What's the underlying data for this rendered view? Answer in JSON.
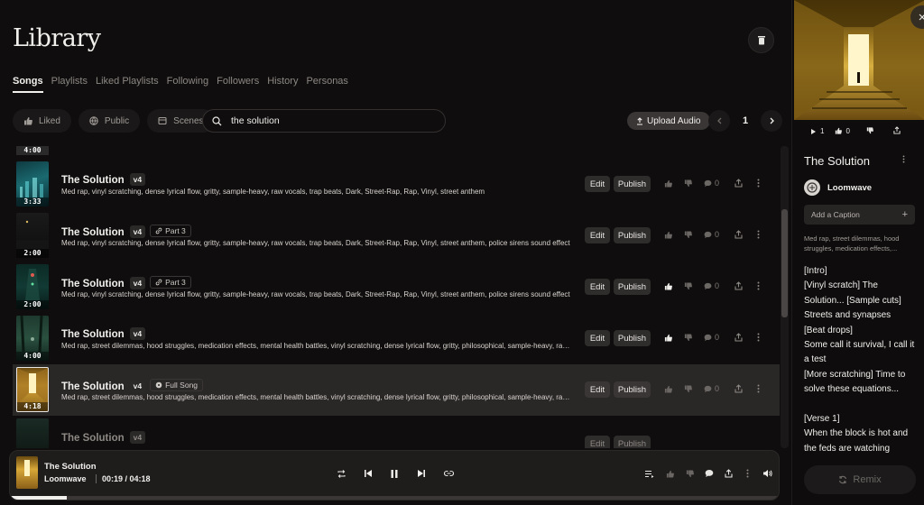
{
  "page": {
    "title": "Library"
  },
  "tabs": [
    {
      "label": "Songs",
      "active": true
    },
    {
      "label": "Playlists",
      "active": false
    },
    {
      "label": "Liked Playlists",
      "active": false
    },
    {
      "label": "Following",
      "active": false
    },
    {
      "label": "Followers",
      "active": false
    },
    {
      "label": "History",
      "active": false
    },
    {
      "label": "Personas",
      "active": false
    }
  ],
  "filters": {
    "liked": "Liked",
    "public": "Public",
    "scenes": "Scenes"
  },
  "search": {
    "value": "the solution",
    "placeholder": "Search"
  },
  "toolbar": {
    "upload_label": "Upload Audio"
  },
  "pagination": {
    "current": "1"
  },
  "partial_row_duration": "4:00",
  "rows": [
    {
      "title": "The Solution",
      "version": "v4",
      "badge": "",
      "duration": "3:33",
      "tags": "Med rap, vinyl scratching, dense lyrical flow, gritty, sample-heavy, raw vocals, trap beats, Dark, Street-Rap, Rap, Vinyl, street anthem",
      "edit": "Edit",
      "publish": "Publish",
      "comments": "0",
      "liked": false
    },
    {
      "title": "The Solution",
      "version": "v4",
      "badge": "Part 3",
      "duration": "2:00",
      "tags": "Med rap, vinyl scratching, dense lyrical flow, gritty, sample-heavy, raw vocals, trap beats, Dark, Street-Rap, Rap, Vinyl, street anthem, police sirens sound effect",
      "edit": "Edit",
      "publish": "Publish",
      "comments": "0",
      "liked": false
    },
    {
      "title": "The Solution",
      "version": "v4",
      "badge": "Part 3",
      "duration": "2:00",
      "tags": "Med rap, vinyl scratching, dense lyrical flow, gritty, sample-heavy, raw vocals, trap beats, Dark, Street-Rap, Rap, Vinyl, street anthem, police sirens sound effect",
      "edit": "Edit",
      "publish": "Publish",
      "comments": "0",
      "liked": true
    },
    {
      "title": "The Solution",
      "version": "v4",
      "badge": "",
      "duration": "4:00",
      "tags": "Med rap, street dilemmas, hood struggles, medication effects, mental health battles, vinyl scratching, dense lyrical flow, gritty, philosophical, sample-heavy, raw vocals",
      "edit": "Edit",
      "publish": "Publish",
      "comments": "0",
      "liked": true
    },
    {
      "title": "The Solution",
      "version": "v4",
      "badge": "Full Song",
      "duration": "4:18",
      "tags": "Med rap, street dilemmas, hood struggles, medication effects, mental health battles, vinyl scratching, dense lyrical flow, gritty, philosophical, sample-heavy, raw vocals",
      "edit": "Edit",
      "publish": "Publish",
      "comments": "0",
      "liked": false
    },
    {
      "title": "The Solution",
      "version": "v4",
      "badge": "",
      "duration": "",
      "tags": "",
      "edit": "Edit",
      "publish": "Publish",
      "comments": "0",
      "liked": false
    }
  ],
  "player": {
    "title": "The Solution",
    "artist": "Loomwave",
    "time": "00:19 / 04:18",
    "progress": 0.074
  },
  "side": {
    "plays": "1",
    "likes": "0",
    "title": "The Solution",
    "artist": "Loomwave",
    "caption_label": "Add a Caption",
    "tags": "Med rap, street dilemmas, hood struggles, medication effects,...",
    "lyrics": "[Intro]\n[Vinyl scratch] The Solution... [Sample cuts]\nStreets and synapses\n[Beat drops]\nSome call it survival, I call it a test\n[More scratching] Time to solve these equations...\n\n[Verse 1]\nWhen the block is hot and the feds are watching",
    "remix_label": "Remix"
  },
  "colors": {
    "background": "#0f0d0d",
    "active_row": "#2a2727",
    "accent_text": "#f2f0ed"
  }
}
